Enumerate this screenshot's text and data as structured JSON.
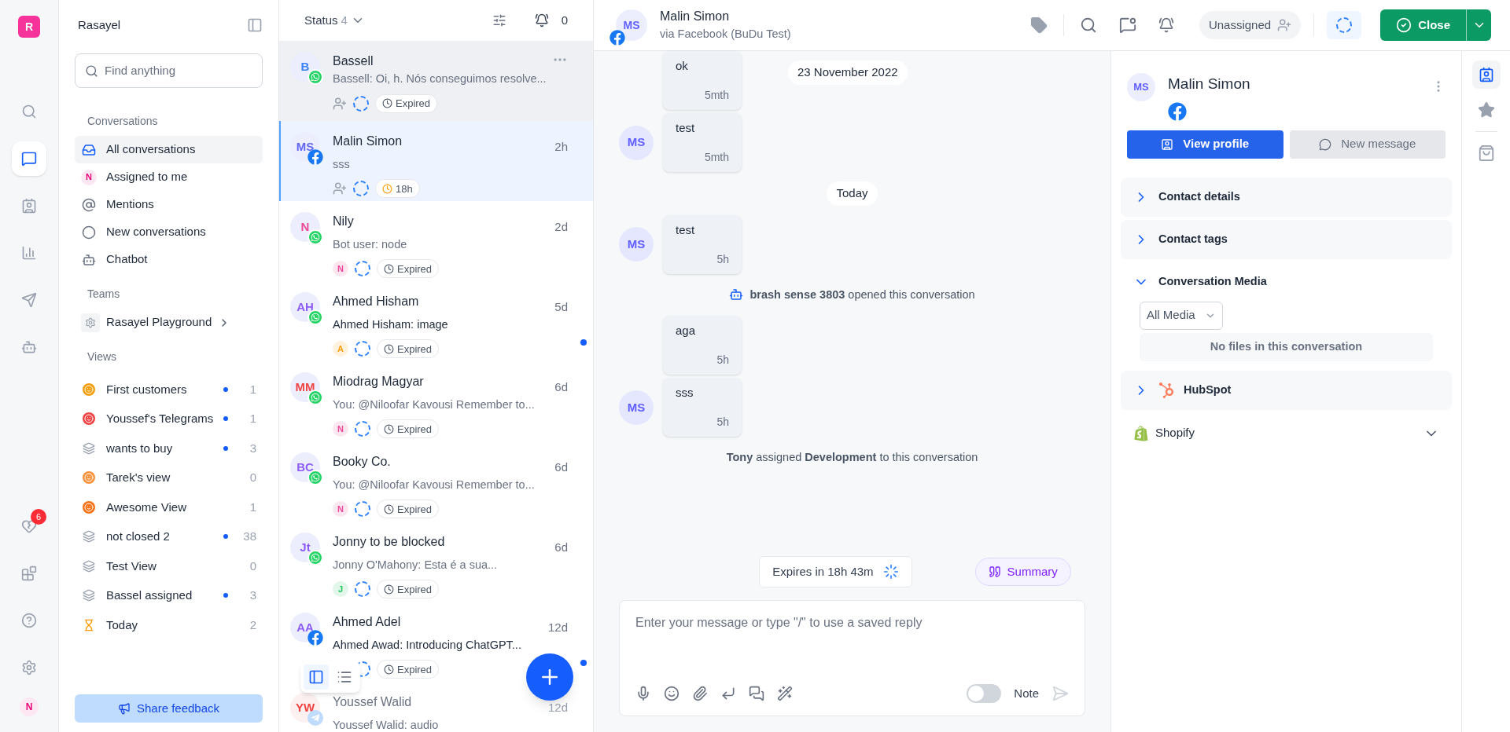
{
  "rail": {
    "logo": "R",
    "notifications_badge": "6",
    "user": "N"
  },
  "sidebar": {
    "title": "Rasayel",
    "search": {
      "placeholder": "Find anything"
    },
    "conversations_heading": "Conversations",
    "conversations": [
      {
        "kind": "inbox",
        "label": "All conversations",
        "selected": true
      },
      {
        "kind": "avatar",
        "letter": "N",
        "label": "Assigned to me",
        "selected": false
      },
      {
        "kind": "mention",
        "label": "Mentions",
        "selected": false
      },
      {
        "kind": "circle",
        "label": "New conversations",
        "selected": false
      },
      {
        "kind": "bot",
        "label": "Chatbot",
        "selected": false
      }
    ],
    "teams_heading": "Teams",
    "team": "Rasayel Playground",
    "views_heading": "Views",
    "views": [
      {
        "kind": "emoji",
        "color": "#f59e0b",
        "label": "First customers",
        "unread": true,
        "count": "1"
      },
      {
        "kind": "emoji",
        "color": "#ef4444",
        "label": "Youssef's Telegrams",
        "unread": true,
        "count": "1"
      },
      {
        "kind": "layers",
        "label": "wants to buy",
        "unread": true,
        "count": "3"
      },
      {
        "kind": "emoji",
        "color": "#fb923c",
        "label": "Tarek's view",
        "unread": false,
        "count": "0"
      },
      {
        "kind": "emoji",
        "color": "#f97316",
        "label": "Awesome View",
        "unread": false,
        "count": "1"
      },
      {
        "kind": "layers",
        "label": "not closed 2",
        "unread": true,
        "count": "38"
      },
      {
        "kind": "layers",
        "label": "Test View",
        "unread": false,
        "count": "0"
      },
      {
        "kind": "layers",
        "label": "Bassel assigned",
        "unread": true,
        "count": "3"
      },
      {
        "kind": "hourglass",
        "label": "Today",
        "unread": false,
        "count": "2"
      }
    ],
    "feedback_button": "Share feedback"
  },
  "list": {
    "status_label": "Status",
    "status_count": "4",
    "snoozed_count": "0",
    "view_modes": [
      {
        "kind": "split",
        "selected": true
      },
      {
        "kind": "list",
        "selected": false
      }
    ],
    "items": [
      {
        "initials": "B",
        "color": "#3b82f6",
        "kind": "whatsapp",
        "name": "Bassell",
        "preview": "Bassell: Oi, h. Nós conseguimos resolve...",
        "unread": false,
        "hovered": true,
        "selected": false,
        "assignee": {
          "kind": "none"
        },
        "timer": {
          "label": "Expired",
          "warning": false
        }
      },
      {
        "initials": "MS",
        "color": "#6366f1",
        "kind": "facebook",
        "name": "Malin Simon",
        "preview": "sss",
        "unread": false,
        "time": "2h",
        "selected": true,
        "assignee": {
          "kind": "none"
        },
        "timer": {
          "label": "18h",
          "warning": true
        }
      },
      {
        "initials": "N",
        "color": "#ec4899",
        "kind": "whatsapp",
        "name": "Nily",
        "preview": "Bot user: node",
        "unread": false,
        "time": "2d",
        "selected": false,
        "assignee": {
          "kind": "letter",
          "letter": "N",
          "color": "#ec4899"
        },
        "timer": {
          "label": "Expired",
          "warning": false
        }
      },
      {
        "initials": "AH",
        "color": "#8b5cf6",
        "kind": "whatsapp",
        "name": "Ahmed Hisham",
        "preview": "Ahmed Hisham: image",
        "unread": true,
        "time": "5d",
        "selected": false,
        "assignee": {
          "kind": "letter",
          "letter": "A",
          "color": "#f59e0b"
        },
        "timer": {
          "label": "Expired",
          "warning": false
        }
      },
      {
        "initials": "MM",
        "color": "#ef4444",
        "kind": "whatsapp",
        "name": "Miodrag Magyar",
        "preview": "You: @Niloofar Kavousi Remember to...",
        "unread": false,
        "time": "6d",
        "selected": false,
        "assignee": {
          "kind": "letter",
          "letter": "N",
          "color": "#ec4899"
        },
        "timer": {
          "label": "Expired",
          "warning": false
        }
      },
      {
        "initials": "BC",
        "color": "#8b5cf6",
        "kind": "whatsapp",
        "name": "Booky Co.",
        "preview": "You: @Niloofar Kavousi Remember to...",
        "unread": false,
        "time": "6d",
        "selected": false,
        "assignee": {
          "kind": "letter",
          "letter": "N",
          "color": "#ec4899"
        },
        "timer": {
          "label": "Expired",
          "warning": false
        }
      },
      {
        "initials": "Jt",
        "color": "#8b5cf6",
        "kind": "whatsapp",
        "name": "Jonny to be blocked",
        "preview": "Jonny O'Mahony: Esta é a sua...",
        "unread": false,
        "time": "6d",
        "selected": false,
        "assignee": {
          "kind": "letter",
          "letter": "J",
          "color": "#22c55e"
        },
        "timer": {
          "label": "Expired",
          "warning": false
        }
      },
      {
        "initials": "AA",
        "color": "#8b5cf6",
        "kind": "facebook",
        "name": "Ahmed Adel",
        "preview": "Ahmed Awad: Introducing ChatGPT...",
        "unread": true,
        "time": "12d",
        "selected": false,
        "assignee": {
          "kind": "hidden"
        },
        "timer": {
          "label": "Expired",
          "warning": false
        }
      },
      {
        "initials": "YW",
        "color": "#ef4444",
        "kind": "telegram",
        "name": "Youssef Walid",
        "preview": "Youssef Walid: audio",
        "unread": false,
        "time": "12d",
        "selected": false,
        "faded": true
      }
    ]
  },
  "chat": {
    "header": {
      "initials": "MS",
      "name": "Malin Simon",
      "via": "via Facebook (BuDu Test)",
      "assign_label": "Unassigned",
      "close_button": "Close"
    },
    "timeline": [
      {
        "kind": "message",
        "text": "ok",
        "time": "5mth",
        "date_chip": "23 November 2022"
      },
      {
        "kind": "message",
        "text": "test",
        "time": "5mth",
        "avatar": "MS"
      },
      {
        "kind": "date",
        "text": "Today"
      },
      {
        "kind": "message",
        "text": "test",
        "time": "5h",
        "avatar": "MS"
      },
      {
        "kind": "automation",
        "text": "**brash sense 3803** opened this conversation"
      },
      {
        "kind": "message",
        "text": "aga",
        "time": "5h"
      },
      {
        "kind": "message",
        "text": "sss",
        "time": "5h",
        "avatar": "MS"
      },
      {
        "kind": "event",
        "text": "**Tony** assigned **Development** to this conversation"
      }
    ],
    "expires": "Expires in 18h 43m",
    "summary_button": "Summary",
    "composer": {
      "placeholder": "Enter your message or type \"/\" to use a saved reply",
      "note_on": false,
      "note_label": "Note"
    }
  },
  "contact": {
    "initials": "MS",
    "name": "Malin Simon",
    "view_profile": "View profile",
    "new_message": "New message",
    "sections": [
      {
        "kind": "plain",
        "title": "Contact details",
        "expanded": false
      },
      {
        "kind": "plain",
        "title": "Contact tags",
        "expanded": false
      },
      {
        "kind": "media",
        "title": "Conversation Media",
        "expanded": true,
        "filter": "All Media",
        "empty": "No files in this conversation"
      },
      {
        "kind": "hubspot",
        "title": "HubSpot",
        "expanded": false
      },
      {
        "kind": "shopify",
        "title": "Shopify",
        "expanded": false
      }
    ]
  }
}
